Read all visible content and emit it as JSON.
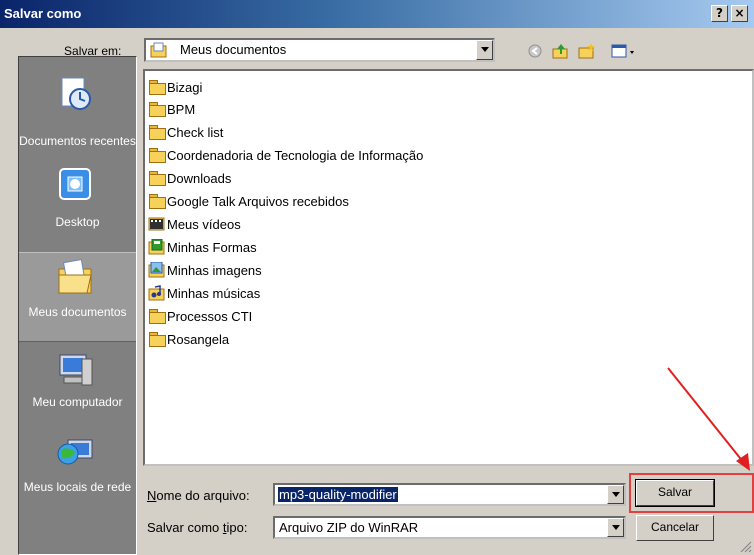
{
  "window": {
    "title": "Salvar como",
    "help_btn": "?",
    "close_btn": "×"
  },
  "toolbar": {
    "save_in_label": "Salvar em:",
    "save_in_value": "Meus documentos",
    "icons": [
      "back-icon",
      "up-folder-icon",
      "new-folder-icon",
      "view-menu-icon"
    ]
  },
  "places": [
    {
      "label": "Documentos recentes",
      "icon": "recent-documents-icon"
    },
    {
      "label": "Desktop",
      "icon": "desktop-icon"
    },
    {
      "label": "Meus documentos",
      "icon": "my-documents-icon",
      "selected": true
    },
    {
      "label": "Meu computador",
      "icon": "my-computer-icon"
    },
    {
      "label": "Meus locais de rede",
      "icon": "network-places-icon"
    }
  ],
  "files": [
    {
      "name": "Bizagi",
      "icon": "folder"
    },
    {
      "name": "BPM",
      "icon": "folder"
    },
    {
      "name": "Check list",
      "icon": "folder"
    },
    {
      "name": "Coordenadoria de Tecnologia de Informação",
      "icon": "folder"
    },
    {
      "name": "Downloads",
      "icon": "folder"
    },
    {
      "name": "Google Talk Arquivos recebidos",
      "icon": "folder"
    },
    {
      "name": "Meus vídeos",
      "icon": "video-folder"
    },
    {
      "name": "Minhas Formas",
      "icon": "forms-folder"
    },
    {
      "name": "Minhas imagens",
      "icon": "pictures-folder"
    },
    {
      "name": "Minhas músicas",
      "icon": "music-folder"
    },
    {
      "name": "Processos CTI",
      "icon": "folder"
    },
    {
      "name": "Rosangela",
      "icon": "folder"
    }
  ],
  "filename": {
    "label": "Nome do arquivo:",
    "value": "mp3-quality-modifier"
  },
  "filetype": {
    "label": "Salvar como tipo:",
    "value": "Arquivo ZIP do WinRAR"
  },
  "buttons": {
    "save": "Salvar",
    "cancel": "Cancelar"
  },
  "colors": {
    "title_start": "#0a246a",
    "title_end": "#a6caf0",
    "selection": "#0a246a",
    "annotation": "#e02020"
  }
}
